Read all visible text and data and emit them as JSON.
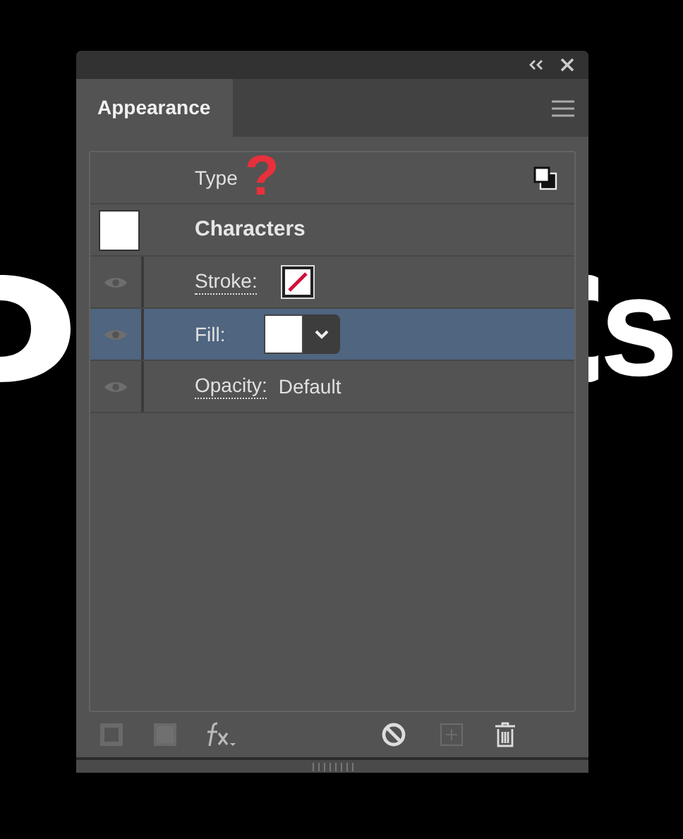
{
  "backdrop": {
    "right": "s"
  },
  "panel": {
    "tab": {
      "label": "Appearance",
      "selected": true
    },
    "annotation": "?",
    "rows": [
      {
        "kind": "header",
        "label": "Type",
        "selected": false
      },
      {
        "kind": "swatch",
        "label": "Characters",
        "selected": false
      },
      {
        "kind": "stroke",
        "label": "Stroke:",
        "selected": false
      },
      {
        "kind": "fill",
        "label": "Fill:",
        "selected": true
      },
      {
        "kind": "opacity",
        "label": "Opacity:",
        "value": "Default",
        "selected": false
      }
    ]
  }
}
